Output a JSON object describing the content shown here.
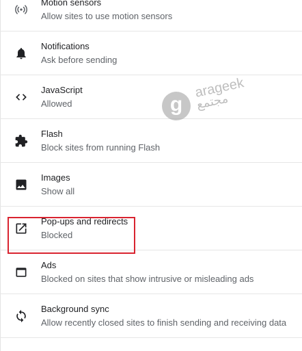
{
  "settings": {
    "items": [
      {
        "icon": "sensors-icon",
        "title": "Motion sensors",
        "subtitle": "Allow sites to use motion sensors"
      },
      {
        "icon": "bell-icon",
        "title": "Notifications",
        "subtitle": "Ask before sending"
      },
      {
        "icon": "code-icon",
        "title": "JavaScript",
        "subtitle": "Allowed"
      },
      {
        "icon": "puzzle-icon",
        "title": "Flash",
        "subtitle": "Block sites from running Flash"
      },
      {
        "icon": "image-icon",
        "title": "Images",
        "subtitle": "Show all"
      },
      {
        "icon": "open-in-new-icon",
        "title": "Pop-ups and redirects",
        "subtitle": "Blocked"
      },
      {
        "icon": "web-window-icon",
        "title": "Ads",
        "subtitle": "Blocked on sites that show intrusive or misleading ads"
      },
      {
        "icon": "sync-icon",
        "title": "Background sync",
        "subtitle": "Allow recently closed sites to finish sending and receiving data"
      }
    ]
  },
  "watermark": {
    "logo_letter": "g",
    "brand_en": "arageek",
    "brand_ar": "مجتمع"
  },
  "colors": {
    "highlight": "#d9232f",
    "icon": "#5f6368"
  }
}
